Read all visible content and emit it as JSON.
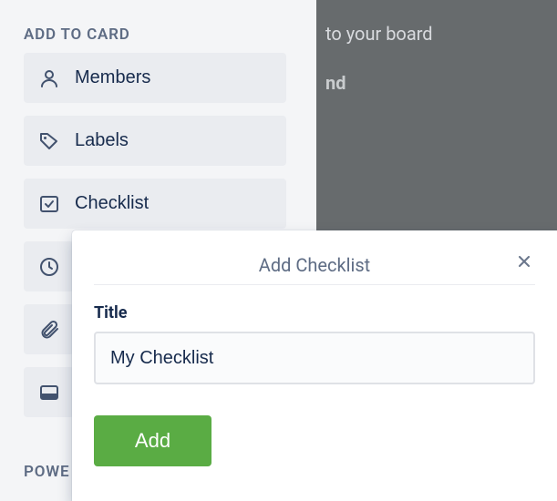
{
  "sidebar": {
    "heading": "ADD TO CARD",
    "items": {
      "members": {
        "label": "Members"
      },
      "labels": {
        "label": "Labels"
      },
      "checklist": {
        "label": "Checklist"
      }
    },
    "power_heading": "POWER-UPS"
  },
  "backdrop": {
    "line1": "to your board",
    "line2": "nd"
  },
  "popover": {
    "title": "Add Checklist",
    "field_label": "Title",
    "input_value": "My Checklist",
    "add_button": "Add"
  }
}
